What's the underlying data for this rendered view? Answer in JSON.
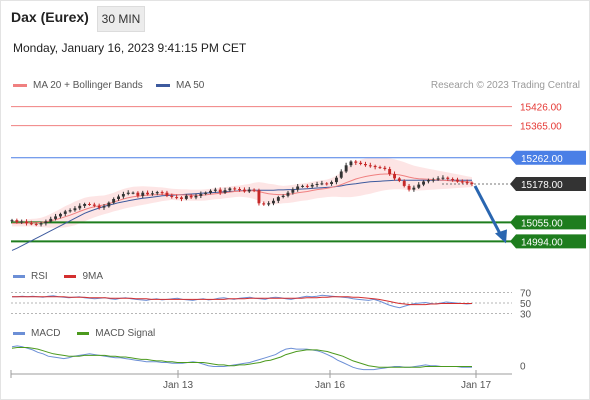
{
  "header": {
    "title": "Dax (Eurex)",
    "timeframe": "30 MIN",
    "datetime": "Monday, January 16, 2023 9:41:15 PM CET"
  },
  "legend": {
    "ma_label": "MA 20 + Bollinger Bands",
    "ma50_label": "MA 50",
    "credit": "Research © 2023 Trading Central"
  },
  "colors": {
    "up": "#333333",
    "down": "#c62828",
    "ma20": "#f08080",
    "band_fill": "#fde2e2",
    "ma50": "#3d5a9e",
    "resistance": "#f08080",
    "pivot": "#4a7fe6",
    "support": "#1e7d1e",
    "current": "#333333",
    "arrow": "#2a66b0",
    "rsi": "#6c8fd6",
    "rsi_ma": "#d32f2f",
    "macd": "#6c8fd6",
    "macd_signal": "#4c9a1e"
  },
  "chart_data": [
    {
      "type": "candlestick",
      "title": "Dax (Eurex)",
      "ylim": [
        14960,
        15460
      ],
      "levels": [
        {
          "value": 15426.0,
          "label": "15426.00",
          "kind": "resistance"
        },
        {
          "value": 15365.0,
          "label": "15365.00",
          "kind": "resistance"
        },
        {
          "value": 15262.0,
          "label": "15262.00",
          "kind": "pivot"
        },
        {
          "value": 15178.0,
          "label": "15178.00",
          "kind": "current"
        },
        {
          "value": 15055.0,
          "label": "15055.00",
          "kind": "support"
        },
        {
          "value": 14994.0,
          "label": "14994.00",
          "kind": "support"
        }
      ],
      "x_ticks": [
        "Jan 13",
        "Jan 16",
        "Jan 17"
      ],
      "series": [
        {
          "name": "MA 20 + Bollinger Bands"
        },
        {
          "name": "MA 50"
        }
      ],
      "close": [
        15062,
        15056,
        15058,
        15052,
        15050,
        15048,
        15052,
        15058,
        15066,
        15074,
        15082,
        15090,
        15094,
        15100,
        15108,
        15114,
        15112,
        15108,
        15102,
        15106,
        15118,
        15130,
        15138,
        15146,
        15150,
        15150,
        15140,
        15150,
        15145,
        15148,
        15152,
        15150,
        15140,
        15136,
        15135,
        15130,
        15140,
        15135,
        15140,
        15146,
        15150,
        15156,
        15160,
        15150,
        15158,
        15164,
        15162,
        15160,
        15154,
        15160,
        15158,
        15116,
        15112,
        15116,
        15124,
        15136,
        15140,
        15150,
        15160,
        15170,
        15172,
        15170,
        15175,
        15178,
        15180,
        15178,
        15184,
        15198,
        15218,
        15238,
        15250,
        15246,
        15242,
        15238,
        15236,
        15232,
        15230,
        15226,
        15210,
        15196,
        15188,
        15172,
        15160,
        15166,
        15176,
        15186,
        15190,
        15192,
        15196,
        15198,
        15194,
        15192,
        15186,
        15184,
        15182,
        15178
      ],
      "ma20": [
        15052,
        15052,
        15052,
        15053,
        15054,
        15054,
        15055,
        15057,
        15060,
        15064,
        15068,
        15073,
        15078,
        15084,
        15090,
        15096,
        15101,
        15105,
        15108,
        15111,
        15115,
        15120,
        15125,
        15130,
        15134,
        15137,
        15139,
        15141,
        15142,
        15143,
        15144,
        15145,
        15145,
        15145,
        15144,
        15143,
        15143,
        15142,
        15142,
        15142,
        15143,
        15145,
        15147,
        15148,
        15150,
        15152,
        15154,
        15155,
        15156,
        15156,
        15156,
        15154,
        15150,
        15147,
        15145,
        15144,
        15144,
        15145,
        15147,
        15150,
        15152,
        15154,
        15157,
        15160,
        15162,
        15164,
        15167,
        15171,
        15176,
        15182,
        15188,
        15194,
        15198,
        15202,
        15205,
        15207,
        15209,
        15210,
        15210,
        15209,
        15207,
        15204,
        15200,
        15197,
        15195,
        15194,
        15193,
        15192,
        15191,
        15190,
        15189,
        15188,
        15187,
        15186,
        15185,
        15184
      ],
      "ma50": [
        14965,
        14972,
        14980,
        14988,
        14996,
        15004,
        15012,
        15020,
        15028,
        15036,
        15044,
        15052,
        15060,
        15068,
        15076,
        15084,
        15090,
        15096,
        15101,
        15106,
        15110,
        15114,
        15118,
        15121,
        15124,
        15127,
        15130,
        15132,
        15134,
        15136,
        15138,
        15140,
        15141,
        15142,
        15143,
        15144,
        15145,
        15146,
        15147,
        15148,
        15149,
        15150,
        15151,
        15152,
        15153,
        15154,
        15155,
        15156,
        15157,
        15158,
        15158,
        15158,
        15158,
        15158,
        15158,
        15159,
        15159,
        15160,
        15160,
        15161,
        15162,
        15163,
        15164,
        15165,
        15166,
        15167,
        15168,
        15170,
        15172,
        15175,
        15177,
        15179,
        15181,
        15183,
        15185,
        15186,
        15187,
        15188,
        15189,
        15190,
        15190,
        15190,
        15190,
        15190,
        15190,
        15190,
        15190,
        15190,
        15190,
        15190,
        15190,
        15190,
        15190,
        15190,
        15190,
        15190
      ],
      "band_width": [
        10,
        10,
        10,
        11,
        12,
        13,
        15,
        18,
        22,
        26,
        30,
        34,
        36,
        38,
        38,
        38,
        36,
        34,
        32,
        30,
        30,
        30,
        31,
        32,
        32,
        32,
        31,
        30,
        28,
        26,
        24,
        22,
        20,
        18,
        18,
        18,
        18,
        18,
        18,
        18,
        18,
        18,
        18,
        18,
        18,
        18,
        18,
        18,
        20,
        22,
        26,
        30,
        32,
        32,
        32,
        30,
        28,
        28,
        28,
        28,
        28,
        28,
        28,
        28,
        28,
        28,
        30,
        34,
        40,
        46,
        52,
        56,
        58,
        58,
        58,
        56,
        54,
        52,
        50,
        48,
        46,
        44,
        42,
        40,
        38,
        36,
        34,
        32,
        30,
        28,
        26,
        24,
        22,
        20,
        18,
        16
      ]
    },
    {
      "type": "line",
      "title": "RSI",
      "ylim": [
        25,
        75
      ],
      "y_ticks": [
        "70",
        "50",
        "30"
      ],
      "series": [
        {
          "name": "RSI",
          "values": [
            62,
            62,
            63,
            62,
            63,
            62,
            61,
            63,
            64,
            62,
            61,
            60,
            61,
            62,
            60,
            59,
            58,
            59,
            60,
            58,
            57,
            59,
            60,
            58,
            57,
            56,
            55,
            57,
            58,
            56,
            57,
            58,
            59,
            57,
            56,
            55,
            57,
            58,
            56,
            57,
            59,
            60,
            58,
            57,
            59,
            60,
            61,
            59,
            58,
            57,
            60,
            61,
            60,
            58,
            57,
            59,
            61,
            63,
            62,
            63,
            65,
            64,
            63,
            62,
            61,
            60,
            58,
            57,
            56,
            55,
            57,
            54,
            50,
            46,
            43,
            41,
            44,
            47,
            49,
            50,
            51,
            49,
            48,
            50,
            52,
            51,
            50,
            49,
            48,
            49
          ]
        },
        {
          "name": "9MA",
          "values": [
            62,
            62,
            62,
            62,
            62,
            62,
            62,
            62,
            62,
            62,
            62,
            61,
            61,
            61,
            61,
            60,
            60,
            60,
            60,
            59,
            59,
            59,
            59,
            59,
            58,
            58,
            58,
            57,
            57,
            57,
            57,
            57,
            57,
            57,
            57,
            57,
            57,
            57,
            57,
            57,
            57,
            57,
            58,
            58,
            58,
            58,
            59,
            59,
            59,
            59,
            59,
            59,
            59,
            59,
            59,
            59,
            59,
            60,
            60,
            60,
            61,
            61,
            62,
            62,
            62,
            62,
            61,
            61,
            60,
            59,
            58,
            57,
            55,
            53,
            51,
            49,
            48,
            47,
            47,
            47,
            47,
            48,
            48,
            49,
            49,
            49,
            49,
            49,
            49,
            49
          ]
        }
      ]
    },
    {
      "type": "line",
      "title": "MACD",
      "ylim": [
        -8,
        30
      ],
      "y_ticks": [
        "0"
      ],
      "series": [
        {
          "name": "MACD",
          "values": [
            24,
            25,
            24,
            22,
            20,
            17,
            15,
            12,
            11,
            10,
            9,
            10,
            12,
            13,
            14,
            15,
            14,
            13,
            12,
            11,
            10,
            10,
            9,
            8,
            7,
            6,
            5,
            5,
            5,
            4,
            4,
            3,
            3,
            3,
            4,
            5,
            4,
            2,
            0,
            -1,
            -1,
            -1,
            0,
            1,
            2,
            3,
            4,
            6,
            8,
            10,
            12,
            14,
            18,
            21,
            22,
            21,
            21,
            21,
            20,
            19,
            17,
            14,
            11,
            7,
            4,
            1,
            -2,
            -4,
            -5,
            -5,
            -5,
            -4,
            -3,
            -2,
            -1,
            -1,
            -2,
            -2,
            -1,
            0,
            1,
            0,
            0,
            -1,
            -1,
            -1,
            -1,
            -2,
            -2,
            -2
          ]
        },
        {
          "name": "MACD Signal",
          "values": [
            22,
            23,
            23,
            23,
            22,
            21,
            19,
            17,
            15,
            14,
            13,
            12,
            12,
            12,
            13,
            13,
            13,
            13,
            13,
            12,
            12,
            11,
            11,
            10,
            9,
            8,
            8,
            7,
            6,
            6,
            5,
            5,
            4,
            4,
            4,
            4,
            4,
            4,
            3,
            2,
            1,
            1,
            0,
            0,
            1,
            1,
            2,
            3,
            4,
            6,
            7,
            9,
            11,
            14,
            16,
            18,
            19,
            20,
            20,
            20,
            19,
            18,
            16,
            14,
            12,
            9,
            6,
            4,
            2,
            0,
            -1,
            -2,
            -2,
            -2,
            -2,
            -2,
            -2,
            -2,
            -2,
            -2,
            -1,
            -1,
            -1,
            -1,
            -1,
            -1,
            -1,
            -1,
            -1,
            -1
          ]
        }
      ]
    }
  ]
}
